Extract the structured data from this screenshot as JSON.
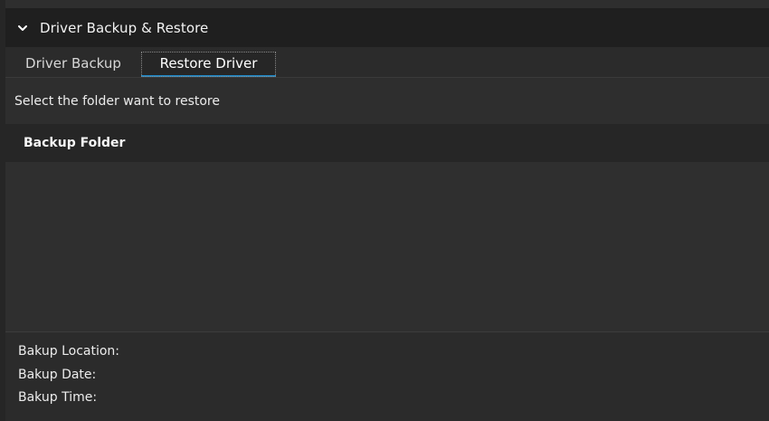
{
  "section": {
    "title": "Driver Backup & Restore",
    "expand_icon": "chevron-down-icon"
  },
  "tabs": [
    {
      "label": "Driver Backup",
      "selected": false
    },
    {
      "label": "Restore Driver",
      "selected": true
    }
  ],
  "restore": {
    "instruction": "Select the folder want to restore",
    "list_header": "Backup Folder",
    "items": []
  },
  "info": {
    "location_label": "Bakup Location:",
    "date_label": "Bakup Date:",
    "time_label": "Bakup Time:"
  },
  "colors": {
    "background": "#2d2d2d",
    "header_background": "#1f1f1f",
    "tab_accent": "#1e88c7",
    "text": "#ffffff"
  }
}
